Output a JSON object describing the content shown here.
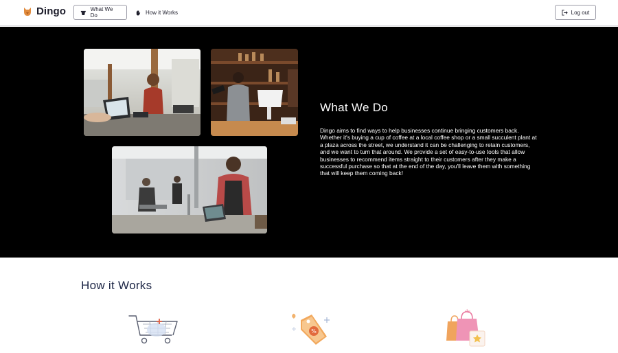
{
  "header": {
    "brand_name": "Dingo",
    "nav": [
      {
        "label": "What We Do",
        "icon": "coffee-cup-icon"
      },
      {
        "label": "How it Works",
        "icon": "hand-icon"
      }
    ],
    "logout_label": "Log out"
  },
  "what": {
    "title": "What We Do",
    "body": "Dingo aims to find ways to help businesses continue bringing customers back. Whether it's buying a cup of coffee at a local coffee shop or a small succulent plant at a plaza across the street, we understand it can be challenging to retain customers, and we want to turn that around. We provide a set of easy-to-use tools that allow businesses to recommend items straight to their customers after they make a successful purchase so that at the end of the day, you'll leave them with something that will keep them coming back!"
  },
  "how": {
    "title": "How it Works",
    "icons": [
      "shopping-cart-icon",
      "discount-tag-icon",
      "shopping-bags-icon"
    ]
  },
  "colors": {
    "brand": "#e08a3c",
    "dark_section": "#000000",
    "heading": "#1b2444"
  }
}
